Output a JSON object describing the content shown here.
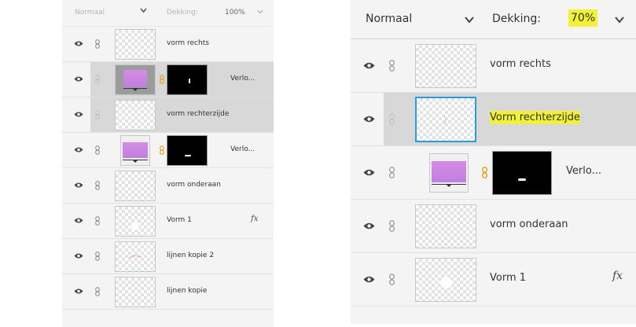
{
  "left_panel": {
    "blend_mode": "Normaal",
    "opacity_label": "Dekking:",
    "opacity_value": "100%",
    "layers": [
      {
        "name": "vorm rechts"
      },
      {
        "name": "Verlo..."
      },
      {
        "name": "vorm rechterzijde"
      },
      {
        "name": "Verlo..."
      },
      {
        "name": "vorm onderaan"
      },
      {
        "name": "Vorm 1",
        "effect": "fx"
      },
      {
        "name": "lijnen kopie 2"
      },
      {
        "name": "lijnen kopie"
      }
    ]
  },
  "right_panel": {
    "blend_mode": "Normaal",
    "opacity_label": "Dekking:",
    "opacity_value": "70%",
    "layers": [
      {
        "name": "vorm rechts"
      },
      {
        "name": "Vorm rechterzijde"
      },
      {
        "name": "Verlo..."
      },
      {
        "name": "vorm onderaan"
      },
      {
        "name": "Vorm 1",
        "effect": "fx"
      }
    ]
  },
  "colors": {
    "highlight": "#f1f03c",
    "selected_row": "#d8d8d8",
    "selected_thumb_border": "#2e9bd6",
    "chain_link": "#e0a020",
    "gradient": "#d48be6"
  }
}
